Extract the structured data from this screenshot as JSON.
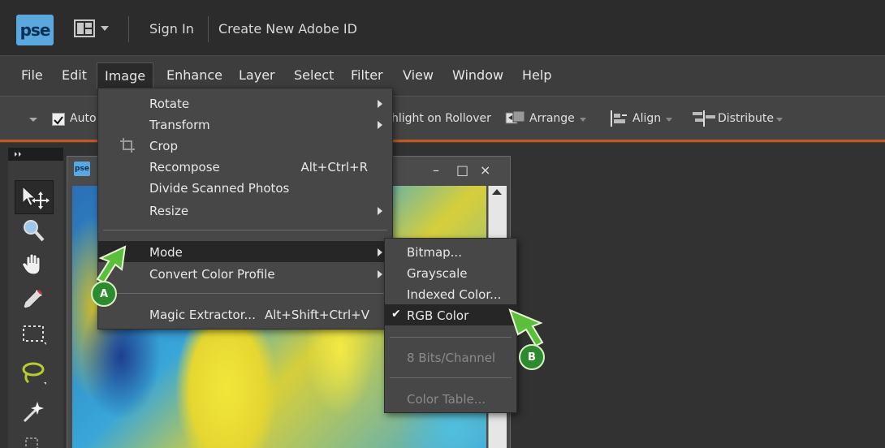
{
  "topbar": {
    "logo": "pse",
    "sign_in": "Sign In",
    "create_id": "Create New Adobe ID"
  },
  "menubar": {
    "items": [
      "File",
      "Edit",
      "Image",
      "Enhance",
      "Layer",
      "Select",
      "Filter",
      "View",
      "Window",
      "Help"
    ],
    "active": "Image"
  },
  "options_bar": {
    "auto_select": "Auto",
    "highlight_rollover": "hlight on Rollover",
    "arrange": "Arrange",
    "align": "Align",
    "distribute": "Distribute"
  },
  "document": {
    "icon": "pse",
    "minimize": "–",
    "maximize": "□",
    "close": "×"
  },
  "image_menu": {
    "items": [
      {
        "label": "Rotate",
        "submenu": true
      },
      {
        "label": "Transform",
        "submenu": true
      },
      {
        "label": "Crop",
        "icon": "crop-icon"
      },
      {
        "label": "Recompose",
        "shortcut": "Alt+Ctrl+R"
      },
      {
        "label": "Divide Scanned Photos"
      },
      {
        "label": "Resize",
        "submenu": true
      },
      {
        "label": "Mode",
        "submenu": true,
        "highlighted": true
      },
      {
        "label": "Convert Color Profile",
        "submenu": true
      },
      {
        "label": "Magic Extractor...",
        "shortcut": "Alt+Shift+Ctrl+V"
      }
    ]
  },
  "mode_menu": {
    "items": [
      {
        "label": "Bitmap..."
      },
      {
        "label": "Grayscale"
      },
      {
        "label": "Indexed Color..."
      },
      {
        "label": "RGB Color",
        "checked": true,
        "highlighted": true
      },
      {
        "label": "8 Bits/Channel",
        "disabled": true
      },
      {
        "label": "Color Table...",
        "disabled": true
      }
    ]
  },
  "callouts": {
    "a": "A",
    "b": "B"
  },
  "colors": {
    "accent_line": "#c8571f",
    "callout_green": "#2e8a2e",
    "logo_blue": "#5aa8dd"
  }
}
